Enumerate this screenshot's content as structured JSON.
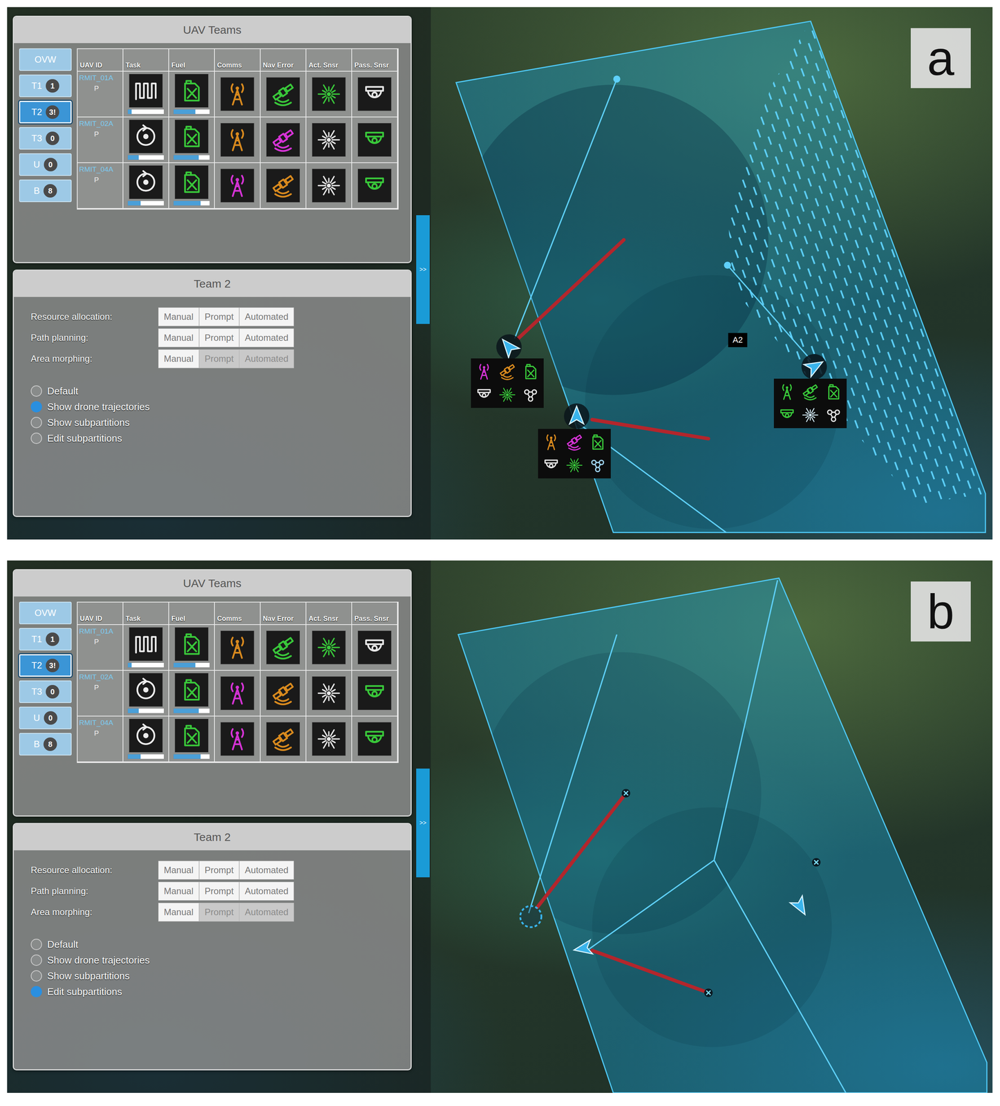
{
  "panels": [
    {
      "label": "a",
      "teams_panel": {
        "title": "UAV Teams",
        "tabs": [
          {
            "label": "OVW",
            "badge": "",
            "selected": false
          },
          {
            "label": "T1",
            "badge": "1",
            "selected": false
          },
          {
            "label": "T2",
            "badge": "3!",
            "selected": true
          },
          {
            "label": "T3",
            "badge": "0",
            "selected": false
          },
          {
            "label": "U",
            "badge": "0",
            "selected": false
          },
          {
            "label": "B",
            "badge": "8",
            "selected": false
          }
        ],
        "columns": [
          "UAV ID",
          "Task",
          "Fuel",
          "Comms",
          "Nav Error",
          "Act. Snsr",
          "Pass. Snsr"
        ],
        "rows": [
          {
            "id": "RMIT_01A",
            "role": "P",
            "task": {
              "kind": "pattern",
              "level": 0.1
            },
            "fuel": {
              "color": "#39c83a",
              "level": 0.6
            },
            "sensors": [
              {
                "kind": "comms",
                "color": "#d98a1e"
              },
              {
                "kind": "nav",
                "color": "#39c83a"
              },
              {
                "kind": "act",
                "color": "#39c83a"
              },
              {
                "kind": "pass",
                "color": "#e6e6e6"
              }
            ]
          },
          {
            "id": "RMIT_02A",
            "role": "P",
            "task": {
              "kind": "orbit",
              "level": 0.3
            },
            "fuel": {
              "color": "#39c83a",
              "level": 0.7
            },
            "sensors": [
              {
                "kind": "comms",
                "color": "#d98a1e"
              },
              {
                "kind": "nav",
                "color": "#d633d6"
              },
              {
                "kind": "act",
                "color": "#e6e6e6"
              },
              {
                "kind": "pass",
                "color": "#39c83a"
              }
            ]
          },
          {
            "id": "RMIT_04A",
            "role": "P",
            "task": {
              "kind": "orbit",
              "level": 0.35
            },
            "fuel": {
              "color": "#39c83a",
              "level": 0.75
            },
            "sensors": [
              {
                "kind": "comms",
                "color": "#d633d6"
              },
              {
                "kind": "nav",
                "color": "#d98a1e"
              },
              {
                "kind": "act",
                "color": "#e6e6e6"
              },
              {
                "kind": "pass",
                "color": "#39c83a"
              }
            ]
          }
        ]
      },
      "team_panel": {
        "title": "Team 2",
        "modes": [
          {
            "label": "Resource allocation:",
            "options": [
              {
                "label": "Manual",
                "selected": false,
                "disabled": false
              },
              {
                "label": "Prompt",
                "selected": false,
                "disabled": false
              },
              {
                "label": "Automated",
                "selected": false,
                "disabled": false
              }
            ]
          },
          {
            "label": "Path planning:",
            "options": [
              {
                "label": "Manual",
                "selected": false,
                "disabled": false
              },
              {
                "label": "Prompt",
                "selected": false,
                "disabled": false
              },
              {
                "label": "Automated",
                "selected": false,
                "disabled": false
              }
            ]
          },
          {
            "label": "Area morphing:",
            "options": [
              {
                "label": "Manual",
                "selected": false,
                "disabled": false
              },
              {
                "label": "Prompt",
                "selected": false,
                "disabled": true
              },
              {
                "label": "Automated",
                "selected": false,
                "disabled": true
              }
            ]
          }
        ],
        "options": [
          {
            "label": "Default",
            "checked": false
          },
          {
            "label": "Show drone trajectories",
            "checked": true
          },
          {
            "label": "Show subpartitions",
            "checked": false
          },
          {
            "label": "Edit subpartitions",
            "checked": false
          }
        ]
      },
      "collapse_tab": ">>",
      "map": {
        "labels": [
          "A2"
        ],
        "markers": [
          {
            "kind": "arrow",
            "status": [
              {
                "kind": "comms",
                "color": "#d633d6"
              },
              {
                "kind": "nav",
                "color": "#d98a1e"
              },
              {
                "kind": "fuel",
                "color": "#39c83a"
              },
              {
                "kind": "pass",
                "color": "#e6e6e6"
              },
              {
                "kind": "act",
                "color": "#39c83a"
              },
              {
                "kind": "network",
                "color": "#e6e6e6"
              }
            ]
          },
          {
            "kind": "arrow",
            "status": [
              {
                "kind": "comms",
                "color": "#d98a1e"
              },
              {
                "kind": "nav",
                "color": "#d633d6"
              },
              {
                "kind": "fuel",
                "color": "#39c83a"
              },
              {
                "kind": "pass",
                "color": "#e6e6e6"
              },
              {
                "kind": "act",
                "color": "#39c83a"
              },
              {
                "kind": "network",
                "color": "#9fd4f0"
              }
            ]
          },
          {
            "kind": "arrow",
            "status": [
              {
                "kind": "comms",
                "color": "#39c83a"
              },
              {
                "kind": "nav",
                "color": "#39c83a"
              },
              {
                "kind": "fuel",
                "color": "#39c83a"
              },
              {
                "kind": "pass",
                "color": "#39c83a"
              },
              {
                "kind": "act",
                "color": "#cfe6f0"
              },
              {
                "kind": "network",
                "color": "#e6e6e6"
              }
            ]
          }
        ]
      }
    },
    {
      "label": "b",
      "teams_panel": {
        "title": "UAV Teams",
        "tabs": [
          {
            "label": "OVW",
            "badge": "",
            "selected": false
          },
          {
            "label": "T1",
            "badge": "1",
            "selected": false
          },
          {
            "label": "T2",
            "badge": "3!",
            "selected": true
          },
          {
            "label": "T3",
            "badge": "0",
            "selected": false
          },
          {
            "label": "U",
            "badge": "0",
            "selected": false
          },
          {
            "label": "B",
            "badge": "8",
            "selected": false
          }
        ],
        "columns": [
          "UAV ID",
          "Task",
          "Fuel",
          "Comms",
          "Nav Error",
          "Act. Snsr",
          "Pass. Snsr"
        ],
        "rows": [
          {
            "id": "RMIT_01A",
            "role": "P",
            "task": {
              "kind": "pattern",
              "level": 0.1
            },
            "fuel": {
              "color": "#39c83a",
              "level": 0.6
            },
            "sensors": [
              {
                "kind": "comms",
                "color": "#d98a1e"
              },
              {
                "kind": "nav",
                "color": "#39c83a"
              },
              {
                "kind": "act",
                "color": "#39c83a"
              },
              {
                "kind": "pass",
                "color": "#e6e6e6"
              }
            ]
          },
          {
            "id": "RMIT_02A",
            "role": "P",
            "task": {
              "kind": "orbit",
              "level": 0.3
            },
            "fuel": {
              "color": "#39c83a",
              "level": 0.7
            },
            "sensors": [
              {
                "kind": "comms",
                "color": "#d633d6"
              },
              {
                "kind": "nav",
                "color": "#d98a1e"
              },
              {
                "kind": "act",
                "color": "#e6e6e6"
              },
              {
                "kind": "pass",
                "color": "#39c83a"
              }
            ]
          },
          {
            "id": "RMIT_04A",
            "role": "P",
            "task": {
              "kind": "orbit",
              "level": 0.35
            },
            "fuel": {
              "color": "#39c83a",
              "level": 0.75
            },
            "sensors": [
              {
                "kind": "comms",
                "color": "#d633d6"
              },
              {
                "kind": "nav",
                "color": "#d98a1e"
              },
              {
                "kind": "act",
                "color": "#e6e6e6"
              },
              {
                "kind": "pass",
                "color": "#39c83a"
              }
            ]
          }
        ]
      },
      "team_panel": {
        "title": "Team 2",
        "modes": [
          {
            "label": "Resource allocation:",
            "options": [
              {
                "label": "Manual",
                "selected": false,
                "disabled": false
              },
              {
                "label": "Prompt",
                "selected": false,
                "disabled": false
              },
              {
                "label": "Automated",
                "selected": false,
                "disabled": false
              }
            ]
          },
          {
            "label": "Path planning:",
            "options": [
              {
                "label": "Manual",
                "selected": false,
                "disabled": false
              },
              {
                "label": "Prompt",
                "selected": false,
                "disabled": false
              },
              {
                "label": "Automated",
                "selected": false,
                "disabled": false
              }
            ]
          },
          {
            "label": "Area morphing:",
            "options": [
              {
                "label": "Manual",
                "selected": false,
                "disabled": false
              },
              {
                "label": "Prompt",
                "selected": false,
                "disabled": true
              },
              {
                "label": "Automated",
                "selected": false,
                "disabled": true
              }
            ]
          }
        ],
        "options": [
          {
            "label": "Default",
            "checked": false
          },
          {
            "label": "Show drone trajectories",
            "checked": false
          },
          {
            "label": "Show subpartitions",
            "checked": false
          },
          {
            "label": "Edit subpartitions",
            "checked": true
          }
        ]
      },
      "collapse_tab": ">>",
      "map": {
        "labels": [],
        "markers": [
          {
            "kind": "ring",
            "status": []
          },
          {
            "kind": "arrow",
            "status": []
          },
          {
            "kind": "arrow",
            "status": []
          }
        ]
      }
    }
  ]
}
